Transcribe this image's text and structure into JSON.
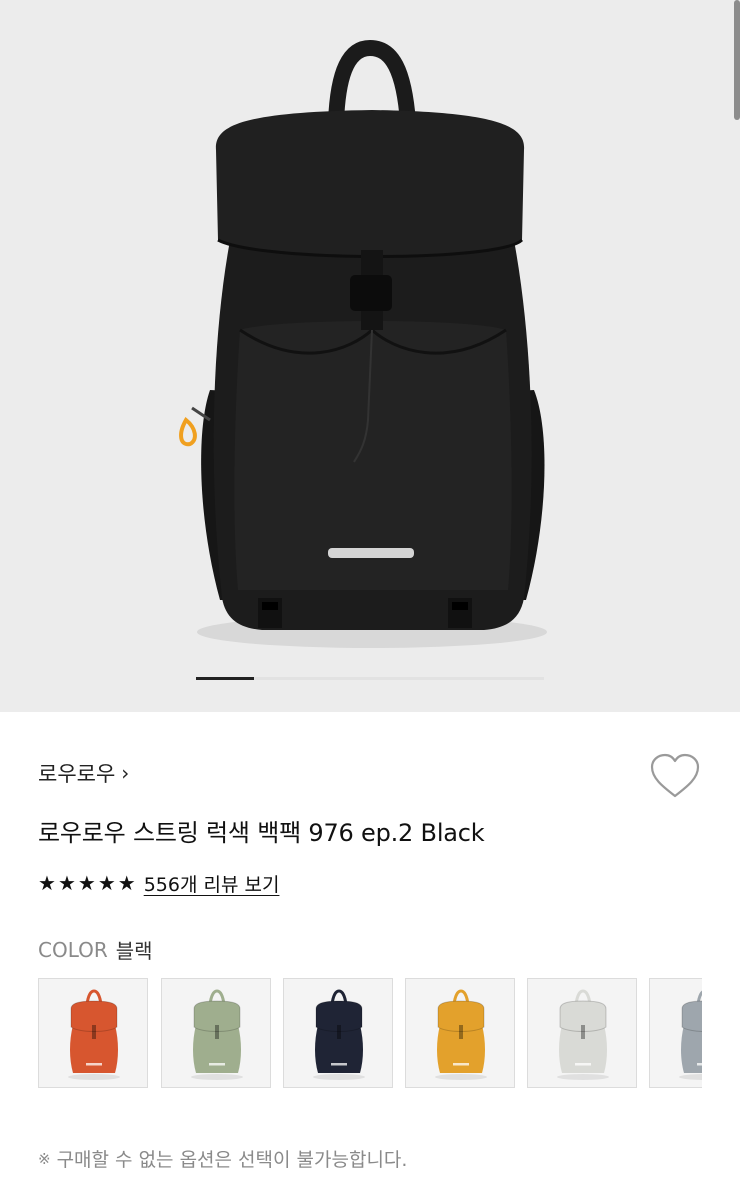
{
  "product": {
    "brand": "로우로우",
    "brand_chevron": "›",
    "title": "로우로우 스트링 럭색 백팩 976 ep.2 Black",
    "review_link": "556개 리뷰 보기",
    "stars": [
      "★",
      "★",
      "★",
      "★",
      "★"
    ],
    "rating_out_of_5": 5
  },
  "gallery": {
    "active_index": 0,
    "colors": {
      "background": "#ececec",
      "bag": "#1b1b1b",
      "accent": "#f0a020"
    }
  },
  "color_option": {
    "label": "COLOR",
    "selected": "블랙"
  },
  "swatches": [
    {
      "name": "red",
      "color": "#d7562f"
    },
    {
      "name": "sage",
      "color": "#9fae8e"
    },
    {
      "name": "navy",
      "color": "#1f2435"
    },
    {
      "name": "mustard",
      "color": "#e3a12c"
    },
    {
      "name": "light-gray",
      "color": "#d9dad6"
    },
    {
      "name": "gray",
      "color": "#9ea6ad"
    }
  ],
  "notice": {
    "mark": "※",
    "text": "구매할 수 없는 옵션은 선택이 불가능합니다."
  },
  "icons": {
    "wishlist": "heart-outline-icon",
    "chevron": "chevron-right-icon",
    "star": "star-icon"
  }
}
